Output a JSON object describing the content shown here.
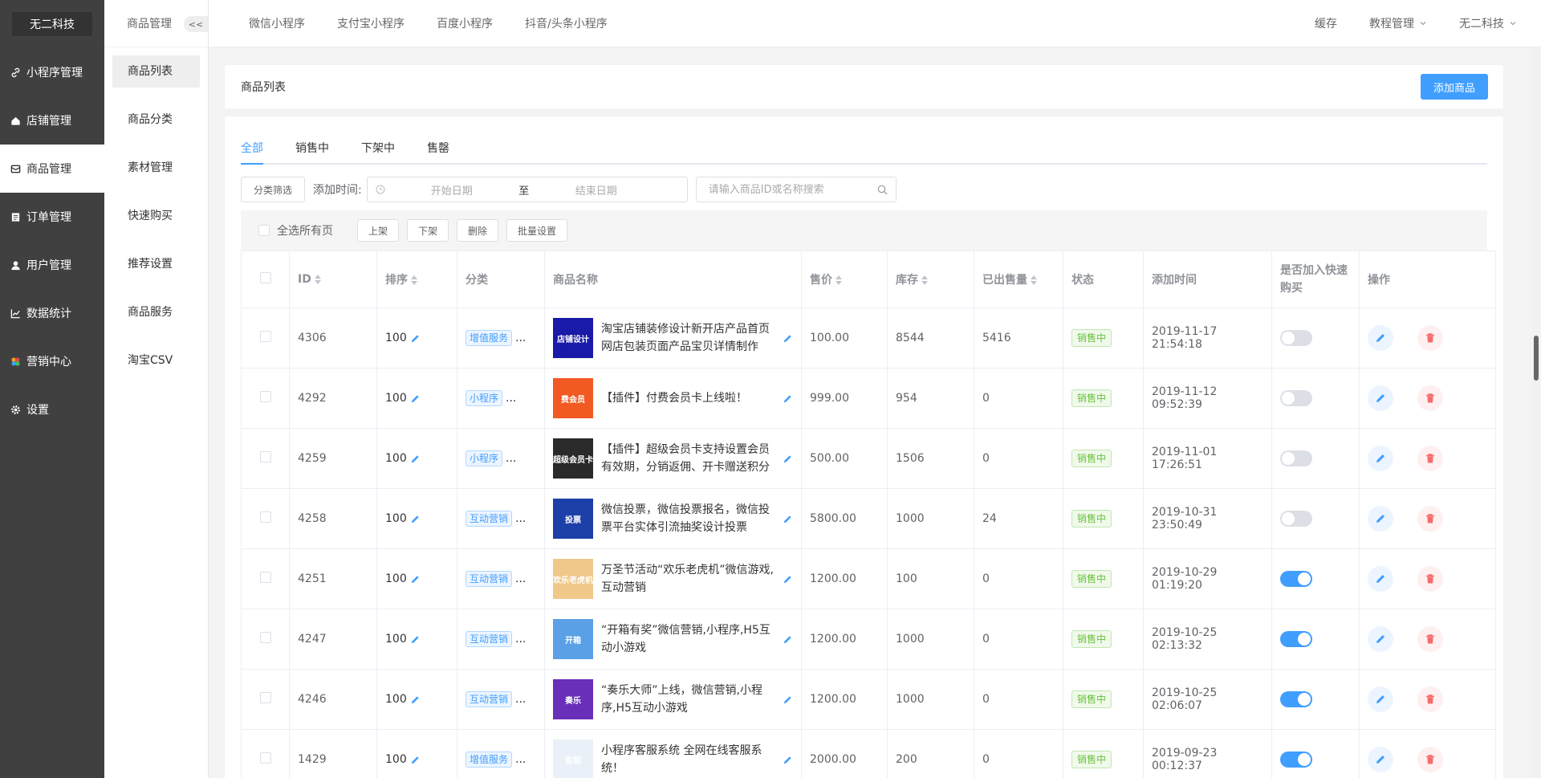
{
  "brand": "无二科技",
  "sidebar": {
    "items": [
      {
        "label": "小程序管理",
        "icon": "link-icon"
      },
      {
        "label": "店铺管理",
        "icon": "home-icon"
      },
      {
        "label": "商品管理",
        "icon": "box-icon",
        "active": true
      },
      {
        "label": "订单管理",
        "icon": "order-icon"
      },
      {
        "label": "用户管理",
        "icon": "user-icon"
      },
      {
        "label": "数据统计",
        "icon": "chart-icon"
      },
      {
        "label": "营销中心",
        "icon": "marketing-icon"
      },
      {
        "label": "设置",
        "icon": "gear-icon"
      }
    ]
  },
  "subnav": {
    "title": "商品管理",
    "collapse": "<<",
    "items": [
      "商品列表",
      "商品分类",
      "素材管理",
      "快速购买",
      "推荐设置",
      "商品服务",
      "淘宝CSV"
    ]
  },
  "topbar": {
    "tabs": [
      "微信小程序",
      "支付宝小程序",
      "百度小程序",
      "抖音/头条小程序"
    ],
    "cache": "缓存",
    "tutorial": "教程管理",
    "account": "无二科技"
  },
  "page": {
    "title": "商品列表",
    "add_button": "添加商品"
  },
  "tabs": [
    "全部",
    "销售中",
    "下架中",
    "售罄"
  ],
  "filter": {
    "category_button": "分类筛选",
    "add_time_label": "添加时间:",
    "start_placeholder": "开始日期",
    "range_sep": "至",
    "end_placeholder": "结束日期",
    "search_placeholder": "请输入商品ID或名称搜索"
  },
  "bulk": {
    "select_all": "全选所有页",
    "on_shelf": "上架",
    "off_shelf": "下架",
    "delete": "删除",
    "batch_settings": "批量设置"
  },
  "table": {
    "headers": {
      "id": "ID",
      "sort": "排序",
      "category": "分类",
      "name": "商品名称",
      "price": "售价",
      "stock": "库存",
      "sold": "已出售量",
      "status": "状态",
      "added": "添加时间",
      "quick_buy": "是否加入快速购买",
      "actions": "操作"
    },
    "ellipsis": "...",
    "rows": [
      {
        "id": "4306",
        "sort": "100",
        "category": "增值服务",
        "name": "淘宝店铺装修设计新开店产品首页网店包装页面产品宝贝详情制作",
        "thumb_text": "店铺设计",
        "thumb_color": "#1a1aa8",
        "price": "100.00",
        "stock": "8544",
        "sold": "5416",
        "status": "销售中",
        "added": "2019-11-17 21:54:18",
        "quick": false
      },
      {
        "id": "4292",
        "sort": "100",
        "category": "小程序",
        "name": "【插件】付费会员卡上线啦！",
        "thumb_text": "费会员",
        "thumb_color": "#f25a23",
        "price": "999.00",
        "stock": "954",
        "sold": "0",
        "status": "销售中",
        "added": "2019-11-12 09:52:39",
        "quick": false
      },
      {
        "id": "4259",
        "sort": "100",
        "category": "小程序",
        "name": "【插件】超级会员卡支持设置会员有效期，分销返佣、开卡赠送积分",
        "thumb_text": "超级会员卡",
        "thumb_color": "#2a2a2a",
        "price": "500.00",
        "stock": "1506",
        "sold": "0",
        "status": "销售中",
        "added": "2019-11-01 17:26:51",
        "quick": false
      },
      {
        "id": "4258",
        "sort": "100",
        "category": "互动营销",
        "name": "微信投票，微信投票报名，微信投票平台实体引流抽奖设计投票",
        "thumb_text": "投票",
        "thumb_color": "#1d3fa8",
        "price": "5800.00",
        "stock": "1000",
        "sold": "24",
        "status": "销售中",
        "added": "2019-10-31 23:50:49",
        "quick": false
      },
      {
        "id": "4251",
        "sort": "100",
        "category": "互动营销",
        "name": "万圣节活动“欢乐老虎机”微信游戏,互动营销",
        "thumb_text": "欢乐老虎机",
        "thumb_color": "#f0c88a",
        "price": "1200.00",
        "stock": "100",
        "sold": "0",
        "status": "销售中",
        "added": "2019-10-29 01:19:20",
        "quick": true
      },
      {
        "id": "4247",
        "sort": "100",
        "category": "互动营销",
        "name": "“开箱有奖”微信营销,小程序,H5互动小游戏",
        "thumb_text": "开箱",
        "thumb_color": "#5aa0e6",
        "price": "1200.00",
        "stock": "1000",
        "sold": "0",
        "status": "销售中",
        "added": "2019-10-25 02:13:32",
        "quick": true
      },
      {
        "id": "4246",
        "sort": "100",
        "category": "互动营销",
        "name": "“奏乐大师”上线，微信营销,小程序,H5互动小游戏",
        "thumb_text": "奏乐",
        "thumb_color": "#6a2fb8",
        "price": "1200.00",
        "stock": "1000",
        "sold": "0",
        "status": "销售中",
        "added": "2019-10-25 02:06:07",
        "quick": true
      },
      {
        "id": "1429",
        "sort": "100",
        "category": "增值服务",
        "name": "小程序客服系统 全网在线客服系统！",
        "thumb_text": "客服",
        "thumb_color": "#e9f0f8",
        "price": "2000.00",
        "stock": "200",
        "sold": "0",
        "status": "销售中",
        "added": "2019-09-23 00:12:37",
        "quick": true
      }
    ]
  }
}
